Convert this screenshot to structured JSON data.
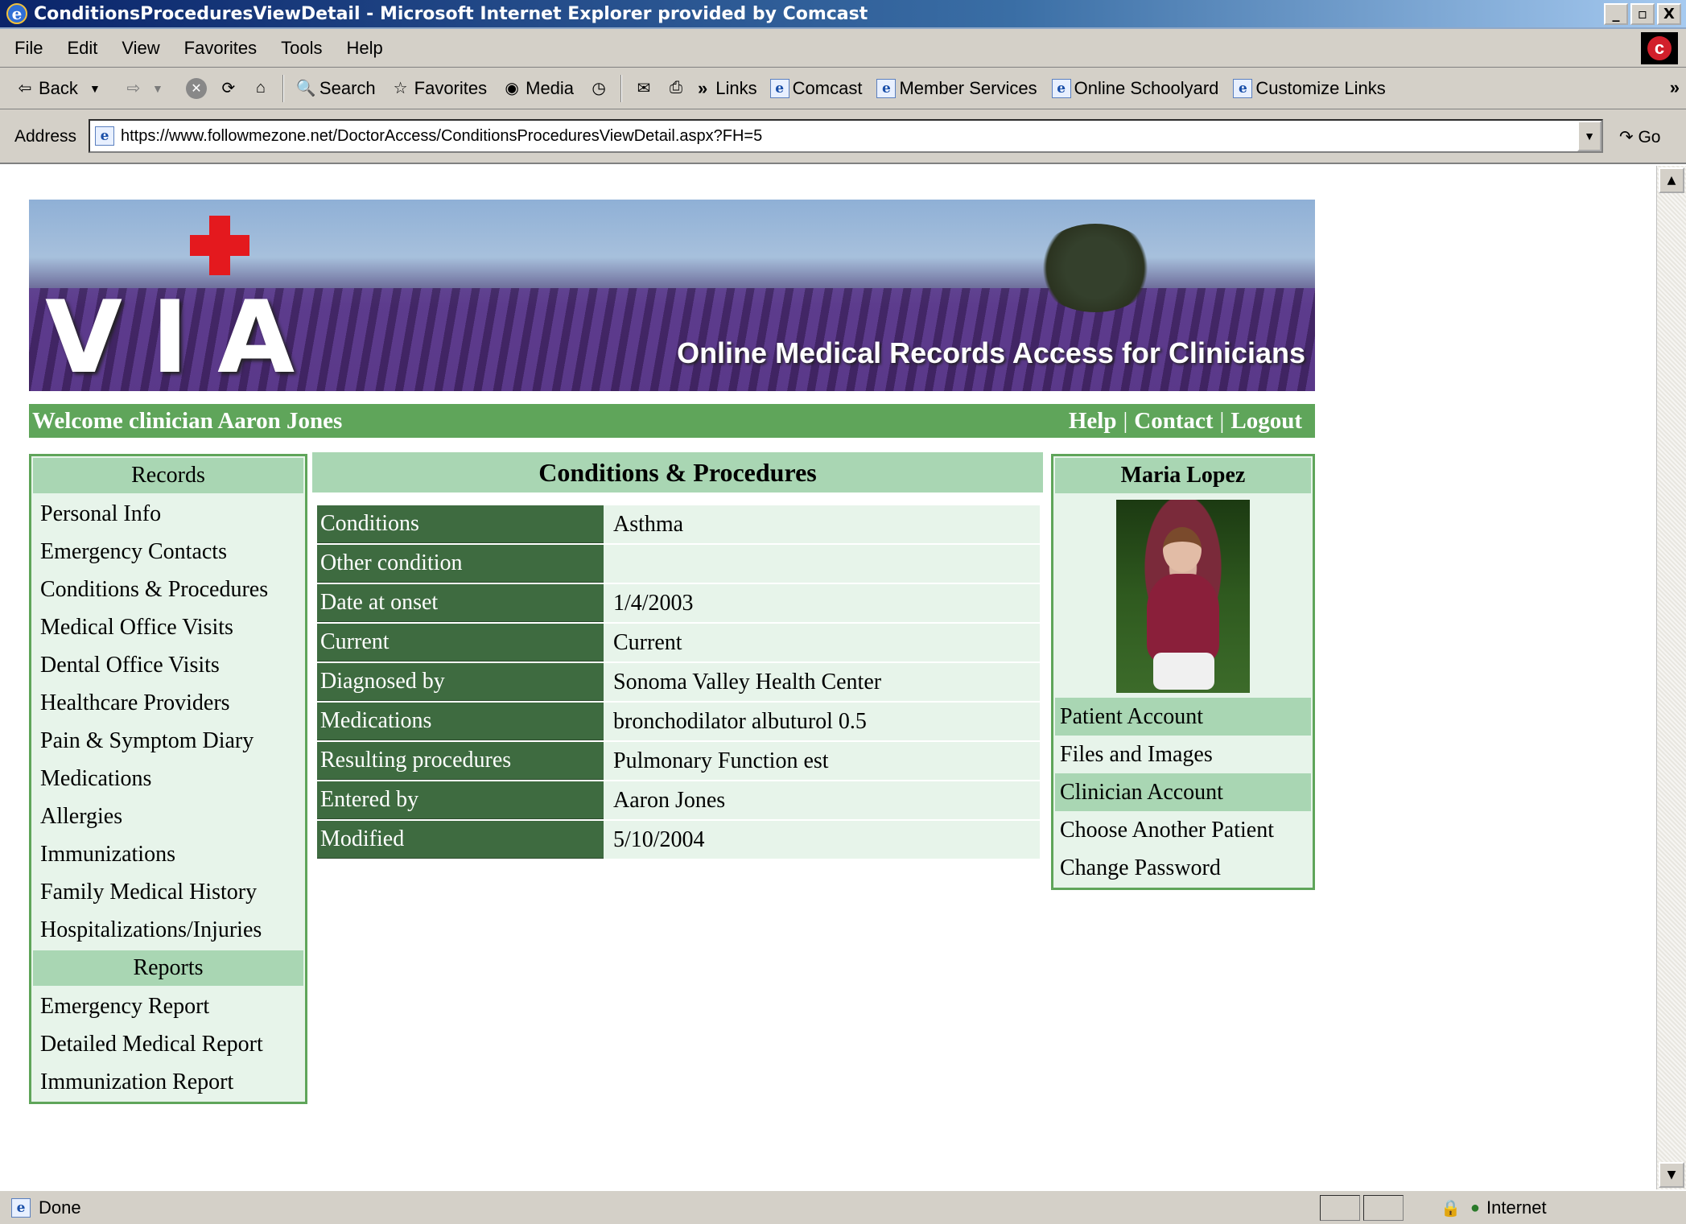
{
  "window": {
    "title": "ConditionsProceduresViewDetail - Microsoft Internet Explorer provided by Comcast",
    "controls": [
      "_",
      "▫",
      "X"
    ]
  },
  "menu": [
    "File",
    "Edit",
    "View",
    "Favorites",
    "Tools",
    "Help"
  ],
  "toolbar": {
    "back": "Back",
    "search": "Search",
    "favorites": "Favorites",
    "media": "Media",
    "links_label": "Links",
    "links": [
      "Comcast",
      "Member Services",
      "Online Schoolyard",
      "Customize Links"
    ]
  },
  "address": {
    "label": "Address",
    "url": "https://www.followmezone.net/DoctorAccess/ConditionsProceduresViewDetail.aspx?FH=5",
    "go": "Go"
  },
  "banner": {
    "logo_letters": [
      "V",
      "I",
      "A"
    ],
    "tagline": "Online Medical Records Access for Clinicians"
  },
  "welcome": {
    "text": "Welcome clinician Aaron Jones",
    "links": [
      "Help",
      "Contact",
      "Logout"
    ],
    "separator": "|"
  },
  "left_nav": {
    "records_heading": "Records",
    "records": [
      "Personal Info",
      "Emergency Contacts",
      "Conditions & Procedures",
      "Medical Office Visits",
      "Dental Office Visits",
      "Healthcare Providers",
      "Pain & Symptom Diary",
      "Medications",
      "Allergies",
      "Immunizations",
      "Family Medical History",
      "Hospitalizations/Injuries"
    ],
    "reports_heading": "Reports",
    "reports": [
      "Emergency Report",
      "Detailed Medical Report",
      "Immunization Report"
    ]
  },
  "detail": {
    "title": "Conditions & Procedures",
    "rows": [
      {
        "label": "Conditions",
        "value": "Asthma"
      },
      {
        "label": "Other condition",
        "value": ""
      },
      {
        "label": "Date at onset",
        "value": "1/4/2003"
      },
      {
        "label": "Current",
        "value": "Current"
      },
      {
        "label": "Diagnosed by",
        "value": "Sonoma Valley Health Center"
      },
      {
        "label": "Medications",
        "value": "bronchodilator albuturol 0.5"
      },
      {
        "label": "Resulting procedures",
        "value": "Pulmonary Function est"
      },
      {
        "label": "Entered by",
        "value": "Aaron Jones"
      },
      {
        "label": "Modified",
        "value": "5/10/2004"
      }
    ]
  },
  "patient": {
    "name": "Maria Lopez",
    "links": [
      "Patient Account",
      "Files and Images",
      "Clinician Account",
      "Choose Another Patient",
      "Change Password"
    ]
  },
  "status": {
    "text": "Done",
    "zone": "Internet"
  }
}
